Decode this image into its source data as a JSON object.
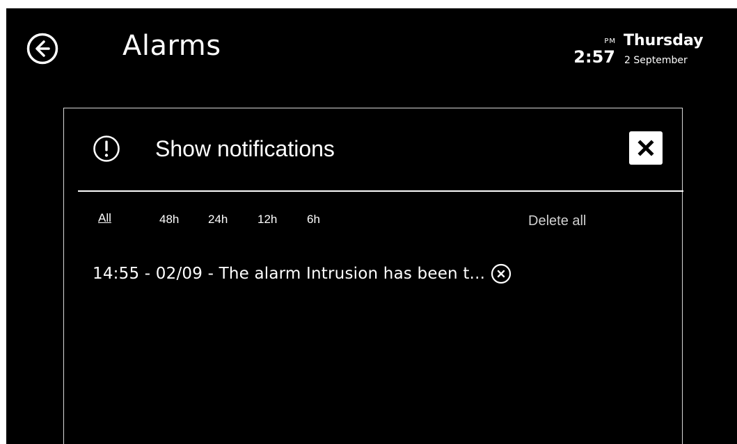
{
  "header": {
    "title": "Alarms",
    "back_icon": "arrow-left-circle-icon"
  },
  "clock": {
    "time": "2:57",
    "ampm": "PM",
    "day": "Thursday",
    "date": "2 September"
  },
  "panel": {
    "title": "Show notifications",
    "alert_icon": "exclamation-circle-icon",
    "close_icon": "close-x-icon",
    "filters": [
      {
        "label": "All",
        "active": true
      },
      {
        "label": "48h",
        "active": false
      },
      {
        "label": "24h",
        "active": false
      },
      {
        "label": "12h",
        "active": false
      },
      {
        "label": "6h",
        "active": false
      }
    ],
    "delete_all_label": "Delete all",
    "notifications": [
      {
        "text": "14:55 - 02/09 - The alarm Intrusion has been t...",
        "dismiss_icon": "dismiss-circle-x-icon"
      }
    ]
  },
  "colors": {
    "background": "#000000",
    "foreground": "#ffffff",
    "muted": "#d0d0d0"
  }
}
